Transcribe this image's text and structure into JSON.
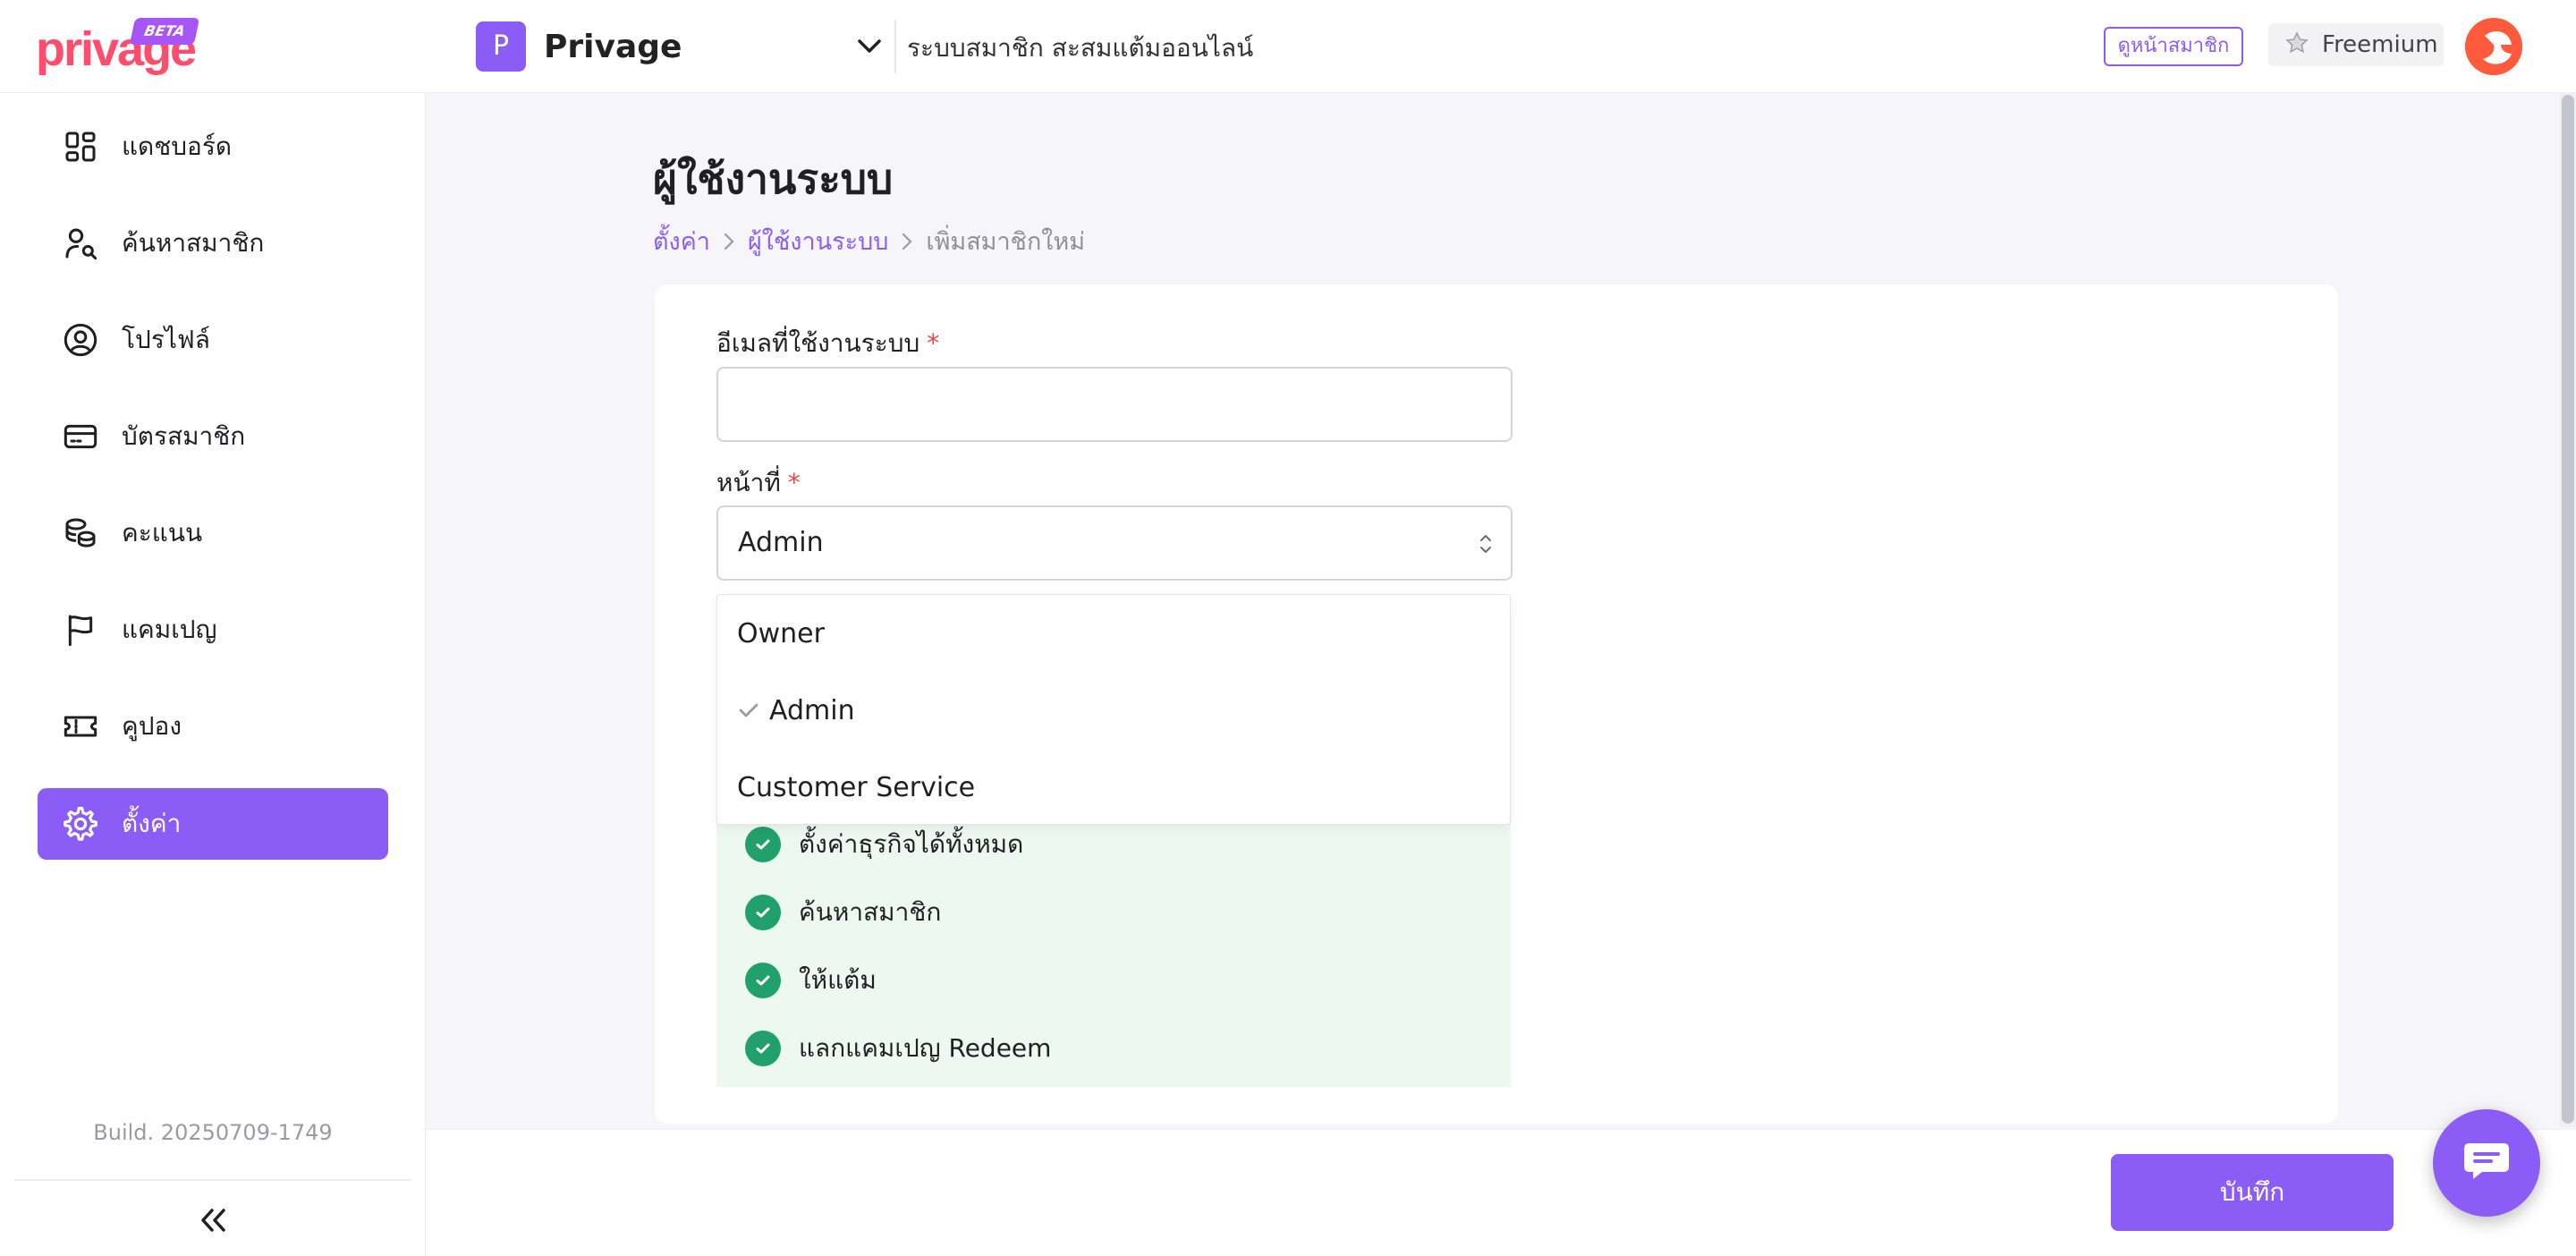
{
  "header": {
    "logo_text": "privage",
    "logo_badge": "BETA",
    "shop_initial": "P",
    "shop_name": "Privage",
    "subtitle": "ระบบสมาชิก สะสมแต้มออนไลน์",
    "view_member_label": "ดูหน้าสมาชิก",
    "plan_label": "Freemium",
    "icons": [
      "chevron-down-icon",
      "star-icon",
      "avatar"
    ]
  },
  "sidebar": {
    "items": [
      {
        "label": "แดชบอร์ด",
        "icon": "dashboard-icon",
        "active": false
      },
      {
        "label": "ค้นหาสมาชิก",
        "icon": "user-search-icon",
        "active": false
      },
      {
        "label": "โปรไฟล์",
        "icon": "profile-icon",
        "active": false
      },
      {
        "label": "บัตรสมาชิก",
        "icon": "card-icon",
        "active": false
      },
      {
        "label": "คะแนน",
        "icon": "coins-icon",
        "active": false
      },
      {
        "label": "แคมเปญ",
        "icon": "flag-icon",
        "active": false
      },
      {
        "label": "คูปอง",
        "icon": "ticket-icon",
        "active": false
      },
      {
        "label": "ตั้งค่า",
        "icon": "gear-icon",
        "active": true
      }
    ],
    "build": "Build. 20250709-1749"
  },
  "main": {
    "title": "ผู้ใช้งานระบบ",
    "breadcrumb": [
      "ตั้งค่า",
      "ผู้ใช้งานระบบ",
      "เพิ่มสมาชิกใหม่"
    ],
    "form": {
      "email_label": "อีเมลที่ใช้งานระบบ",
      "email_value": "",
      "role_label": "หน้าที่",
      "required_mark": "*",
      "role_value": "Admin",
      "role_options": [
        "Owner",
        "Admin",
        "Customer Service"
      ],
      "selected_option": "Admin"
    },
    "permissions": [
      "ตั้งค่าธุรกิจได้ทั้งหมด",
      "ค้นหาสมาชิก",
      "ให้แต้ม",
      "แลกแคมเปญ Redeem"
    ]
  },
  "footer": {
    "save_label": "บันทึก"
  },
  "colors": {
    "accent": "#8b5cf6",
    "logo": "#ff4d6d",
    "success": "#22a06b",
    "permission_bg": "#ecf8f0",
    "required": "#ef4444"
  }
}
